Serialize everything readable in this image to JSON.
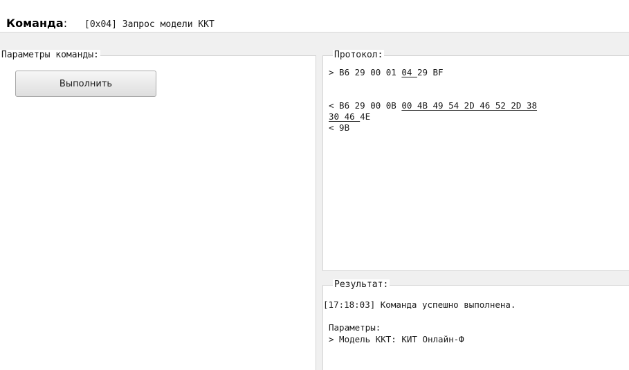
{
  "header": {
    "command_label": "Команда",
    "command_colon": ":",
    "command_value": "[0x04] Запрос модели ККТ"
  },
  "params_group": {
    "title": "Параметры команды:",
    "run_button_label": "Выполнить"
  },
  "protocol_group": {
    "title": "Протокол:",
    "tx_line": {
      "prefix": "> B6 29 00 01 ",
      "underlined": "04 ",
      "suffix": "29 BF"
    },
    "rx_line1": {
      "prefix": "< B6 29 00 0B ",
      "underlined": "00 4B 49 54 2D 46 52 2D 38"
    },
    "rx_line2": {
      "underlined": "30 46 ",
      "suffix": "4E"
    },
    "rx_line3": "< 9B"
  },
  "result_group": {
    "title": "Результат:",
    "status_line": "[17:18:03] Команда успешно выполнена.",
    "params_label": "Параметры:",
    "model_line": "> Модель ККТ: КИТ Онлайн-Ф"
  }
}
